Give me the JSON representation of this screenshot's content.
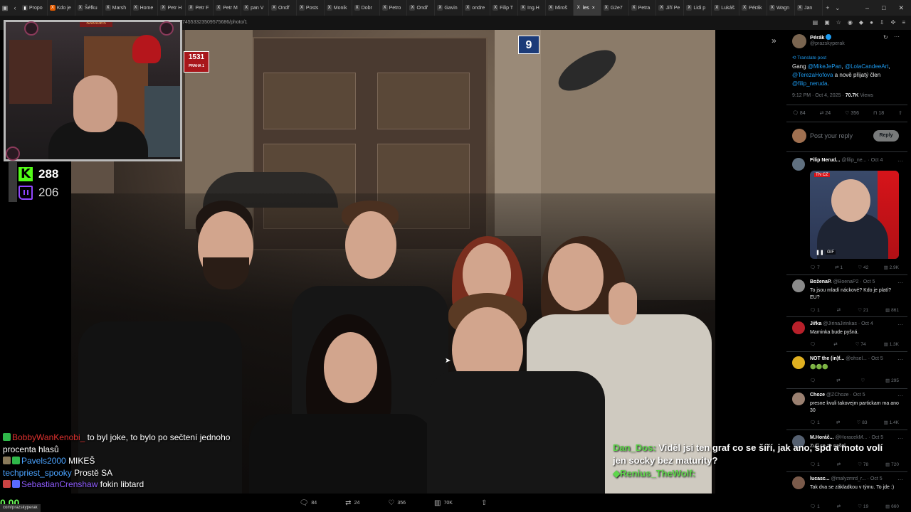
{
  "browser": {
    "tabs": [
      {
        "label": "Propo",
        "icon": "bookmark-icon"
      },
      {
        "label": "Kdo je",
        "icon": "x-icon"
      },
      {
        "label": "Šéfku",
        "icon": "x-icon"
      },
      {
        "label": "Marsh",
        "icon": "x-icon"
      },
      {
        "label": "Home",
        "icon": "x-icon"
      },
      {
        "label": "Petr H",
        "icon": "x-icon"
      },
      {
        "label": "Petr F",
        "icon": "x-icon"
      },
      {
        "label": "Petr M",
        "icon": "x-icon"
      },
      {
        "label": "pan V",
        "icon": "x-icon"
      },
      {
        "label": "Ondř",
        "icon": "x-icon"
      },
      {
        "label": "Posts",
        "icon": "x-icon"
      },
      {
        "label": "Monik",
        "icon": "x-icon"
      },
      {
        "label": "Dobr",
        "icon": "x-icon"
      },
      {
        "label": "Petro",
        "icon": "x-icon"
      },
      {
        "label": "Ondř",
        "icon": "x-icon"
      },
      {
        "label": "Gavin",
        "icon": "x-icon"
      },
      {
        "label": "ondre",
        "icon": "x-icon"
      },
      {
        "label": "Filip T",
        "icon": "x-icon"
      },
      {
        "label": "Ing.H",
        "icon": "x-icon"
      },
      {
        "label": "Miroš",
        "icon": "x-icon"
      },
      {
        "label": "les",
        "icon": "x-icon",
        "active": true
      },
      {
        "label": "G2e7",
        "icon": "x-icon"
      },
      {
        "label": "Petra",
        "icon": "x-icon"
      },
      {
        "label": "Jiří Pe",
        "icon": "x-icon"
      },
      {
        "label": "Lidi p",
        "icon": "x-icon"
      },
      {
        "label": "Lukáš",
        "icon": "x-icon"
      },
      {
        "label": "Pérák",
        "icon": "x-icon"
      },
      {
        "label": "Wagn",
        "icon": "x-icon"
      },
      {
        "label": "Jan",
        "icon": "x-icon"
      }
    ],
    "url_fragment": "74553323509575686/photo/1",
    "new_tab": "+",
    "window_controls": [
      "–",
      "□",
      "✕"
    ]
  },
  "counters": {
    "kick_icon": "K",
    "kick_viewers": "288",
    "twitch_viewers": "206"
  },
  "webcam": {
    "banner": "SAVAGES"
  },
  "photo": {
    "sign_number": "1531",
    "sign_sub": "PRAHA 1",
    "door_number": "9",
    "actions": {
      "replies": "84",
      "reposts": "24",
      "likes": "356",
      "views": "70K"
    }
  },
  "stream_chat_left": [
    {
      "user": "BobbyWanKenobi_",
      "text": "to byl joke, to bylo po sečtení jednoho procenta hlasů",
      "color": "#e0312f"
    },
    {
      "user": "Pavels2000",
      "text": "MIKEŠ",
      "color": "#4aa3ff"
    },
    {
      "user": "techpriest_spooky",
      "text": "Prostě SA",
      "color": "#4aa3ff"
    },
    {
      "user": "SebastianCrenshaw",
      "text": "fokin libtard",
      "color": "#8f5bff"
    }
  ],
  "stream_chat_right": {
    "user1": "Dan_Dos:",
    "text1": "Viděl jsi ten graf co se šíří, jak ano, spd a moto volí jen socky bez maturity?",
    "user2": "Renius_TheWolf:"
  },
  "bottom_tag": "com/prazskyperak",
  "green_zero": "0.00",
  "post": {
    "author": "Pérák",
    "handle": "@prazskyperak",
    "translate": "Translate post",
    "text_prefix": "Gang ",
    "mention1": "@MikeJePan",
    "sep1": ", ",
    "mention2": "@LolaCandeeArt",
    "sep2": ",",
    "mention3": "@TerezaHofova",
    "middle": " a nově přijatý člen",
    "mention4": "@filip_neruda",
    "end": ".",
    "time": "9:12 PM · Oct 4, 2025 · ",
    "views": "70.7K",
    "views_label": " Views",
    "stats": {
      "replies": "84",
      "reposts": "24",
      "likes": "356",
      "bookmarks": "18"
    },
    "reply_placeholder": "Post your reply",
    "reply_button": "Reply"
  },
  "replies": [
    {
      "name": "Filip Nerud...",
      "meta": "@filip_ne... · Oct 4",
      "text": "",
      "stats": [
        "7",
        "1",
        "42",
        "2.9K"
      ],
      "has_media": true,
      "media_label": "GIF",
      "media_logo": "TN CZ"
    },
    {
      "name": "BoženaP.",
      "meta": "@BoenaP2 · Oct 5",
      "text": "To jsou mladí náckové? Kdo je platí? EU?",
      "stats": [
        "1",
        "",
        "21",
        "861"
      ]
    },
    {
      "name": "Jiřka",
      "meta": "@JirinaJirinkas · Oct 4",
      "text": "Maminka bude pyšná.",
      "stats": [
        "",
        "",
        "74",
        "1.3K"
      ]
    },
    {
      "name": "NOT the (in)f...",
      "meta": "@ohsel... · Oct 5",
      "text": "🟢🟢🟢",
      "stats": [
        "",
        "",
        "",
        "295"
      ]
    },
    {
      "name": "Choze",
      "meta": "@ZChoze · Oct 5",
      "text": "presne kvuli takovejm partickam ma ano 30",
      "stats": [
        "1",
        "",
        "83",
        "1.4K"
      ]
    },
    {
      "name": "M.Horáč...",
      "meta": "@HoracekM... · Oct 5",
      "text": "Zuří se ze našel.",
      "stats": [
        "1",
        "",
        "78",
        "720"
      ]
    },
    {
      "name": "lucasc...",
      "meta": "@malyzmrd_r... · Oct 5",
      "text": "Tak dva se základkou v týmu. To jde :)",
      "stats": [
        "1",
        "",
        "19",
        "660"
      ]
    }
  ]
}
